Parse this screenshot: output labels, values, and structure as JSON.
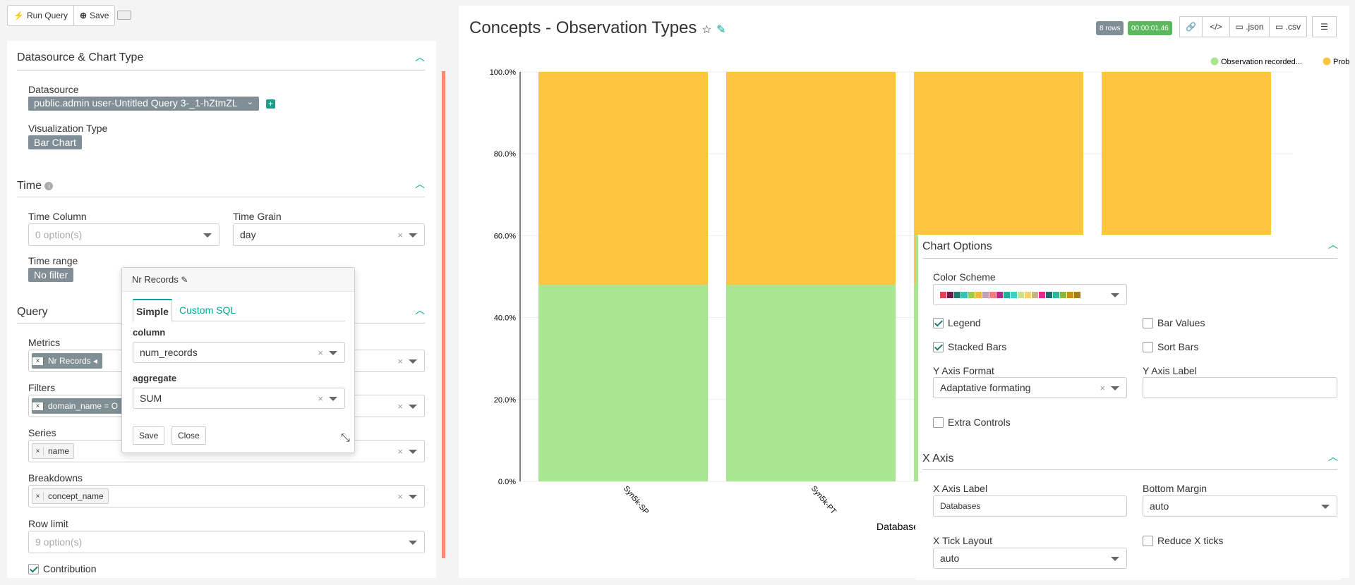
{
  "toolbar": {
    "run_query": "Run Query",
    "save": "Save"
  },
  "datasource_section": {
    "title": "Datasource & Chart Type",
    "datasource_label": "Datasource",
    "datasource_value": "public.admin user-Untitled Query 3-_1-hZtmZL",
    "viz_label": "Visualization Type",
    "viz_value": "Bar Chart"
  },
  "time_section": {
    "title": "Time",
    "time_column_label": "Time Column",
    "time_column_placeholder": "0 option(s)",
    "time_grain_label": "Time Grain",
    "time_grain_value": "day",
    "time_range_label": "Time range",
    "time_range_value": "No filter"
  },
  "query_section": {
    "title": "Query",
    "metrics_label": "Metrics",
    "metric_chip": "Nr Records",
    "filters_label": "Filters",
    "filter_chip": "domain_name = O",
    "series_label": "Series",
    "series_chip": "name",
    "breakdowns_label": "Breakdowns",
    "breakdown_chip": "concept_name",
    "row_limit_label": "Row limit",
    "row_limit_placeholder": "9 option(s)",
    "contribution_label": "Contribution"
  },
  "popover": {
    "title": "Nr Records",
    "tab_simple": "Simple",
    "tab_sql": "Custom SQL",
    "column_label": "column",
    "column_value": "num_records",
    "aggregate_label": "aggregate",
    "aggregate_value": "SUM",
    "save": "Save",
    "close": "Close"
  },
  "chart_header": {
    "title": "Concepts - Observation Types",
    "rows_badge": "8 rows",
    "time_badge": "00:00:01.46",
    "json": ".json",
    "csv": ".csv"
  },
  "chart_data": {
    "type": "bar",
    "stacked": true,
    "categories": [
      "Syn5k-SP",
      "Syn5k-PT",
      "",
      ""
    ],
    "series": [
      {
        "name": "Observation recorded...",
        "color": "#a8e692",
        "values": [
          48,
          48,
          48,
          48
        ]
      },
      {
        "name": "Problem list from EH...",
        "color": "#fec53f",
        "values": [
          52,
          52,
          52,
          52
        ]
      }
    ],
    "yticks": [
      "0.0%",
      "20.0%",
      "40.0%",
      "60.0%",
      "80.0%",
      "100.0%"
    ],
    "ylim": [
      0,
      100
    ],
    "xlabel": "Databases",
    "legend": "top-right"
  },
  "chart_options": {
    "title": "Chart Options",
    "color_scheme_label": "Color Scheme",
    "legend": "Legend",
    "bar_values": "Bar Values",
    "stacked_bars": "Stacked Bars",
    "sort_bars": "Sort Bars",
    "y_axis_format_label": "Y Axis Format",
    "y_axis_format_value": "Adaptative formating",
    "y_axis_label_label": "Y Axis Label",
    "extra_controls": "Extra Controls",
    "swatches": [
      "#e04355",
      "#6b1a4a",
      "#1f7c73",
      "#3bbfb6",
      "#a2c848",
      "#f8b63a",
      "#c0a4b6",
      "#f87a7a",
      "#b22a86",
      "#26ada2",
      "#3ad1c9",
      "#c7e58b",
      "#f7d26b",
      "#c8b28b",
      "#e8288e",
      "#1e6b6c",
      "#2fb69e",
      "#8ab83c",
      "#c98f1a",
      "#a67c1f"
    ]
  },
  "x_axis": {
    "title": "X Axis",
    "x_axis_label_label": "X Axis Label",
    "x_axis_label_value": "Databases",
    "bottom_margin_label": "Bottom Margin",
    "bottom_margin_value": "auto",
    "x_tick_layout_label": "X Tick Layout",
    "x_tick_layout_value": "auto",
    "reduce_x_ticks": "Reduce X ticks"
  }
}
